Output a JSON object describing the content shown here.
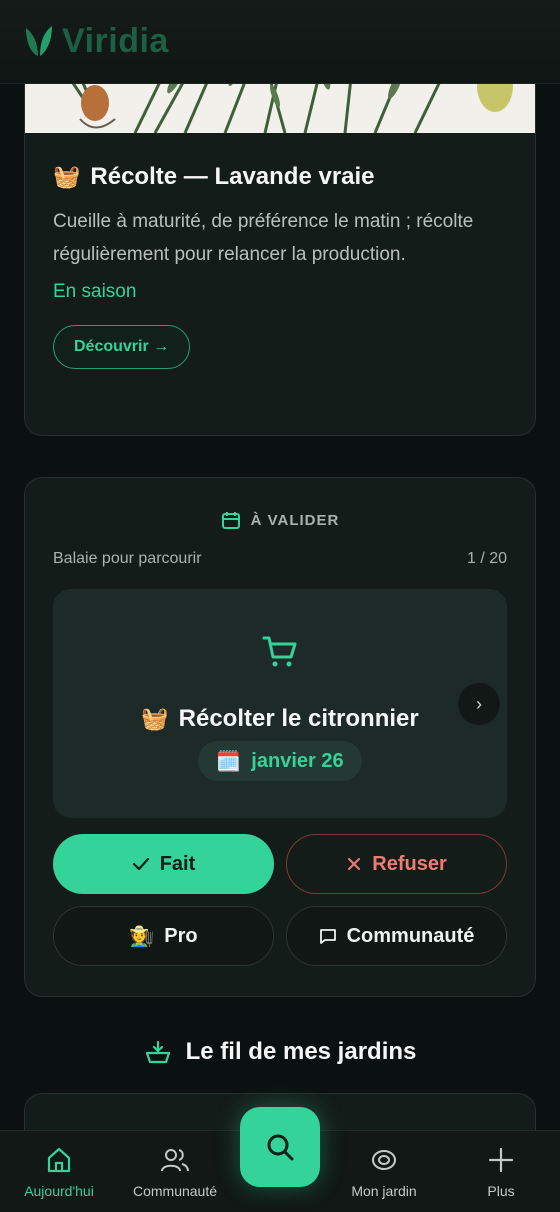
{
  "app": {
    "name": "Viridia"
  },
  "tip_card": {
    "emoji": "🧺",
    "title": "Récolte — Lavande vraie",
    "description": "Cueille à maturité, de préférence le matin ; récolte régulièrement pour relancer la production.",
    "season": "En saison",
    "discover_label": "Découvrir →"
  },
  "validate_card": {
    "heading": "À VALIDER",
    "hint": "Balaie pour parcourir",
    "counter": "1 / 20",
    "task": {
      "icon": "cart-icon",
      "emoji": "🧺",
      "title": "Récolter le citronnier",
      "date_emoji": "🗓️",
      "date": "janvier 26"
    },
    "done_label": "Fait",
    "refuse_label": "Refuser",
    "pro_emoji": "🧑‍🌾",
    "pro_label": "Pro",
    "community_label": "Communauté"
  },
  "feed": {
    "title": "Le fil de mes jardins"
  },
  "bottom_nav": {
    "items": [
      {
        "label": "Aujourd'hui",
        "icon": "home-icon",
        "active": true
      },
      {
        "label": "Communauté",
        "icon": "users-icon"
      },
      {
        "label": "Mon jardin",
        "icon": "garden-icon"
      },
      {
        "label": "Plus",
        "icon": "plus-icon"
      }
    ],
    "search_icon": "search-icon"
  },
  "colors": {
    "accent": "#34d399",
    "background": "#0b1110",
    "card": "#141c1a",
    "danger": "#f07b72"
  }
}
